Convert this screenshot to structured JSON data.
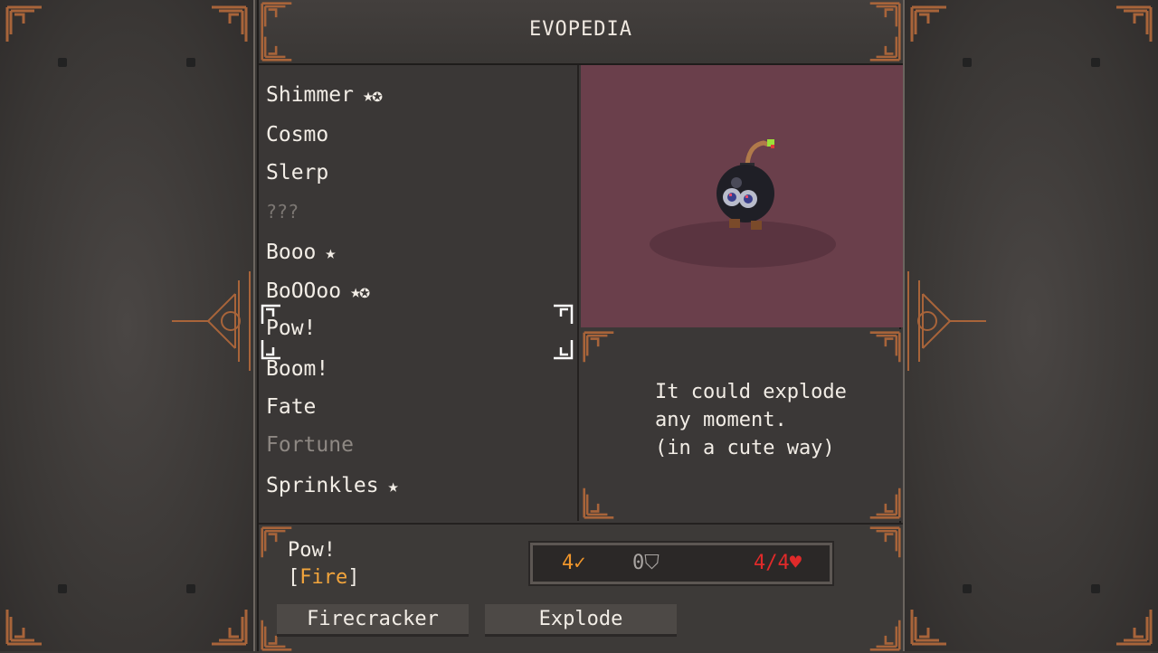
{
  "title": "EVOPEDIA",
  "list": [
    {
      "name": "Shimmer",
      "stars": "★✪",
      "state": "normal"
    },
    {
      "name": "Cosmo",
      "stars": "",
      "state": "normal"
    },
    {
      "name": "Slerp",
      "stars": "",
      "state": "normal"
    },
    {
      "name": "???",
      "stars": "",
      "state": "unknown"
    },
    {
      "name": "Booo",
      "stars": "★",
      "state": "normal"
    },
    {
      "name": "BoOOoo",
      "stars": "★✪",
      "state": "normal"
    },
    {
      "name": "Pow!",
      "stars": "",
      "state": "selected"
    },
    {
      "name": "Boom!",
      "stars": "",
      "state": "normal"
    },
    {
      "name": "Fate",
      "stars": "",
      "state": "normal"
    },
    {
      "name": "Fortune",
      "stars": "",
      "state": "dim"
    },
    {
      "name": "Sprinkles",
      "stars": "★",
      "state": "normal"
    }
  ],
  "description": {
    "line1": "It could explode",
    "line2": "any moment.",
    "line3": "(in a cute way)"
  },
  "selected": {
    "name": "Pow!",
    "type": "Fire",
    "attack": "4",
    "defense": "0",
    "hp": "4/4"
  },
  "skills": [
    "Firecracker",
    "Explode"
  ],
  "icons": {
    "attack": "sword-icon",
    "defense": "shield-icon",
    "hp": "heart-icon",
    "star": "star-icon",
    "badge": "gear-badge-icon"
  },
  "colors": {
    "accent_orange": "#f3a53c",
    "hp_red": "#e02a2a",
    "portrait_bg": "#6a3f4b",
    "ornament": "#b0683a"
  }
}
